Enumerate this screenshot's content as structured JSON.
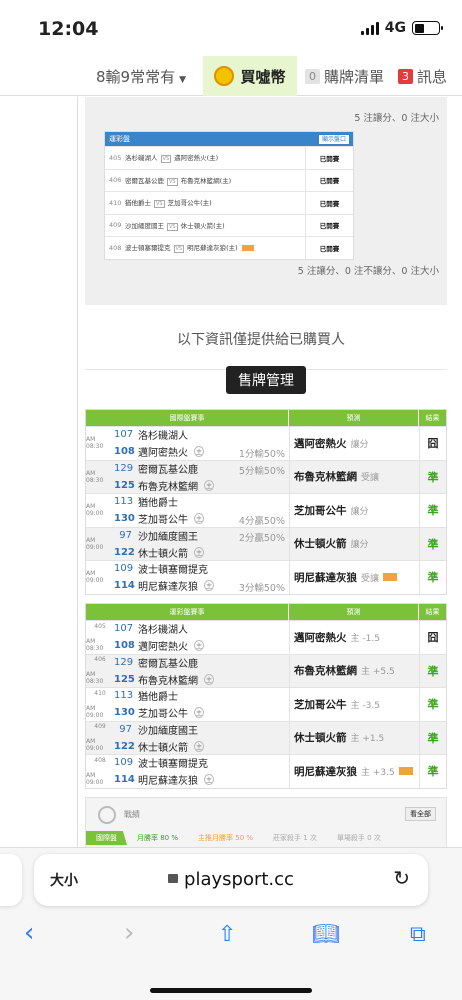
{
  "status": {
    "time": "12:04",
    "network": "4G"
  },
  "nav": {
    "user": "8輸9常常有",
    "buy": "買噓幣",
    "cart_label": "購牌清單",
    "cart_count": "0",
    "msg_label": "訊息",
    "msg_count": "3"
  },
  "summary_top": "5 注讓分、0 注大小",
  "mini_table": {
    "title": "運彩盤",
    "show_btn": "顯示盤口",
    "rows": [
      {
        "id": "405",
        "away": "洛杉磯湖人",
        "home": "邁阿密熱火(主)",
        "status": "已開賽"
      },
      {
        "id": "406",
        "away": "密爾瓦基公鹿",
        "home": "布魯克林籃網(主)",
        "status": "已開賽"
      },
      {
        "id": "410",
        "away": "猶他爵士",
        "home": "芝加哥公牛(主)",
        "status": "已開賽"
      },
      {
        "id": "409",
        "away": "沙加緬度國王",
        "home": "休士頓火箭(主)",
        "status": "已開賽"
      },
      {
        "id": "408",
        "away": "波士頓塞爾提克",
        "home": "明尼蘇達灰狼(主)",
        "status": "已開賽"
      }
    ]
  },
  "summary_bottom": "5 注讓分、0 注不讓分、0 注大小",
  "notice": "以下資訊僅提供給已購買人",
  "sell_button": "售牌管理",
  "home_mark": "主",
  "intl_table": {
    "headers": [
      "國際盤賽事",
      "預測",
      "結果"
    ],
    "rows": [
      {
        "time": "AM 08:30",
        "n1": "107",
        "t1": "洛杉磯湖人",
        "n2": "108",
        "t2": "邁阿密熱火",
        "handicap": "1分輸50%",
        "pick": "邁阿密熱火",
        "note": "讓分",
        "result": "囧"
      },
      {
        "time": "AM 08:30",
        "n1": "129",
        "t1": "密爾瓦基公鹿",
        "n2": "125",
        "t2": "布魯克林籃網",
        "handicap": "5分輸50%",
        "pick": "布魯克林籃網",
        "note": "受讓",
        "result": "準"
      },
      {
        "time": "AM 09:00",
        "n1": "113",
        "t1": "猶他爵士",
        "n2": "130",
        "t2": "芝加哥公牛",
        "handicap": "4分贏50%",
        "pick": "芝加哥公牛",
        "note": "讓分",
        "result": "準"
      },
      {
        "time": "AM 09:00",
        "n1": "97",
        "t1": "沙加緬度國王",
        "n2": "122",
        "t2": "休士頓火箭",
        "handicap": "2分贏50%",
        "pick": "休士頓火箭",
        "note": "讓分",
        "result": "準"
      },
      {
        "time": "AM 09:00",
        "n1": "109",
        "t1": "波士頓塞爾提克",
        "n2": "114",
        "t2": "明尼蘇達灰狼",
        "handicap": "3分輸50%",
        "pick": "明尼蘇達灰狼",
        "note": "受讓",
        "result": "準"
      }
    ]
  },
  "lottery_table": {
    "headers": [
      "運彩盤賽事",
      "預測",
      "結果"
    ],
    "rows": [
      {
        "id": "405",
        "time": "AM 08:30",
        "n1": "107",
        "t1": "洛杉磯湖人",
        "n2": "108",
        "t2": "邁阿密熱火",
        "pick": "邁阿密熱火",
        "note": "主 -1.5",
        "result": "囧"
      },
      {
        "id": "406",
        "time": "AM 08:30",
        "n1": "129",
        "t1": "密爾瓦基公鹿",
        "n2": "125",
        "t2": "布魯克林籃網",
        "pick": "布魯克林籃網",
        "note": "主 +5.5",
        "result": "準"
      },
      {
        "id": "410",
        "time": "AM 09:00",
        "n1": "113",
        "t1": "猶他爵士",
        "n2": "130",
        "t2": "芝加哥公牛",
        "pick": "芝加哥公牛",
        "note": "主 -3.5",
        "result": "準"
      },
      {
        "id": "409",
        "time": "AM 09:00",
        "n1": "97",
        "t1": "沙加緬度國王",
        "n2": "122",
        "t2": "休士頓火箭",
        "pick": "休士頓火箭",
        "note": "主 +1.5",
        "result": "準"
      },
      {
        "id": "408",
        "time": "AM 09:00",
        "n1": "109",
        "t1": "波士頓塞爾提克",
        "n2": "114",
        "t2": "明尼蘇達灰狼",
        "pick": "明尼蘇達灰狼",
        "note": "主 +3.5",
        "result": "準"
      }
    ]
  },
  "record": {
    "label": "戰績",
    "view_all": "看全部",
    "tabs": [
      "國際盤",
      "月勝率 80 %",
      "主推月勝率 50 %",
      "莊家殺手 1 次",
      "單場殺手 0 次"
    ]
  },
  "safari": {
    "aa": "大小",
    "url": "playsport.cc"
  }
}
